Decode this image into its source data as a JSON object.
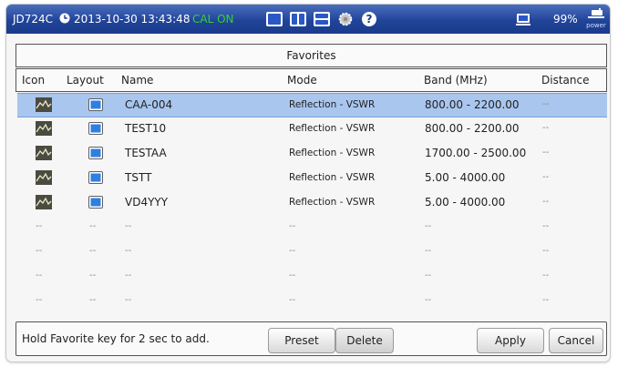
{
  "status_bar": {
    "model": "JD724C",
    "datetime": "2013-10-30 13:43:48",
    "cal_status": "CAL ON",
    "battery_percent": "99%",
    "power_label": "power",
    "toolbar_icons": [
      "single-view-icon",
      "dual-view-icon",
      "split-view-icon",
      "settings-gear-icon",
      "help-icon"
    ]
  },
  "favorites": {
    "title": "Favorites",
    "columns": [
      "Icon",
      "Layout",
      "Name",
      "Mode",
      "Band (MHz)",
      "Distance"
    ],
    "selected_index": 0,
    "rows": [
      {
        "name": "CAA-004",
        "mode": "Reflection - VSWR",
        "band": "800.00 - 2200.00",
        "distance": "--"
      },
      {
        "name": "TEST10",
        "mode": "Reflection - VSWR",
        "band": "800.00 - 2200.00",
        "distance": "--"
      },
      {
        "name": "TESTAA",
        "mode": "Reflection - VSWR",
        "band": "1700.00 - 2500.00",
        "distance": "--"
      },
      {
        "name": "TSTT",
        "mode": "Reflection - VSWR",
        "band": "5.00 - 4000.00",
        "distance": "--"
      },
      {
        "name": "VD4YYY",
        "mode": "Reflection - VSWR",
        "band": "5.00 - 4000.00",
        "distance": "--"
      }
    ],
    "empty_row_placeholder": "--"
  },
  "bottom_bar": {
    "hint": "Hold Favorite key for 2 sec to add.",
    "preset_label": "Preset",
    "delete_label": "Delete",
    "apply_label": "Apply",
    "cancel_label": "Cancel"
  },
  "colors": {
    "status_bar": "#21449a",
    "cal_on": "#34d234",
    "selected_row": "#a9c6ee"
  }
}
